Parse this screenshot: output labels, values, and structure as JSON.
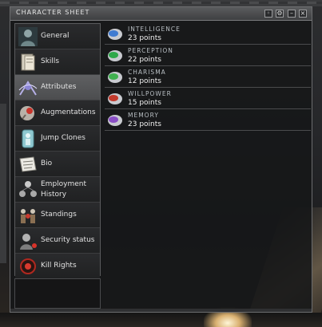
{
  "window": {
    "title": "CHARACTER SHEET",
    "buttons": [
      {
        "name": "info-icon",
        "glyph": "◦"
      },
      {
        "name": "settings-icon",
        "glyph": "⚙"
      },
      {
        "name": "minimize-icon",
        "glyph": "–"
      },
      {
        "name": "close-icon",
        "glyph": "×"
      }
    ]
  },
  "sidebar": {
    "items": [
      {
        "label": "General",
        "icon": "general-icon",
        "active": false
      },
      {
        "label": "Skills",
        "icon": "skills-icon",
        "active": false
      },
      {
        "label": "Attributes",
        "icon": "attributes-icon",
        "active": true
      },
      {
        "label": "Augmentations",
        "icon": "augmentations-icon",
        "active": false
      },
      {
        "label": "Jump Clones",
        "icon": "jump-clones-icon",
        "active": false
      },
      {
        "label": "Bio",
        "icon": "bio-icon",
        "active": false
      },
      {
        "label": "Employment History",
        "icon": "employment-history-icon",
        "active": false
      },
      {
        "label": "Standings",
        "icon": "standings-icon",
        "active": false
      },
      {
        "label": "Security status",
        "icon": "security-status-icon",
        "active": false
      },
      {
        "label": "Kill Rights",
        "icon": "kill-rights-icon",
        "active": false
      }
    ]
  },
  "attributes": [
    {
      "name": "INTELLIGENCE",
      "points": "23 points",
      "icon": "intelligence-icon",
      "color": "#3f7bd1"
    },
    {
      "name": "PERCEPTION",
      "points": "22 points",
      "icon": "perception-icon",
      "color": "#2fa84a"
    },
    {
      "name": "CHARISMA",
      "points": "12 points",
      "icon": "charisma-icon",
      "color": "#3fb04f"
    },
    {
      "name": "WILLPOWER",
      "points": "15 points",
      "icon": "willpower-icon",
      "color": "#c33a2c"
    },
    {
      "name": "MEMORY",
      "points": "23 points",
      "icon": "memory-icon",
      "color": "#8a4fc6"
    }
  ]
}
